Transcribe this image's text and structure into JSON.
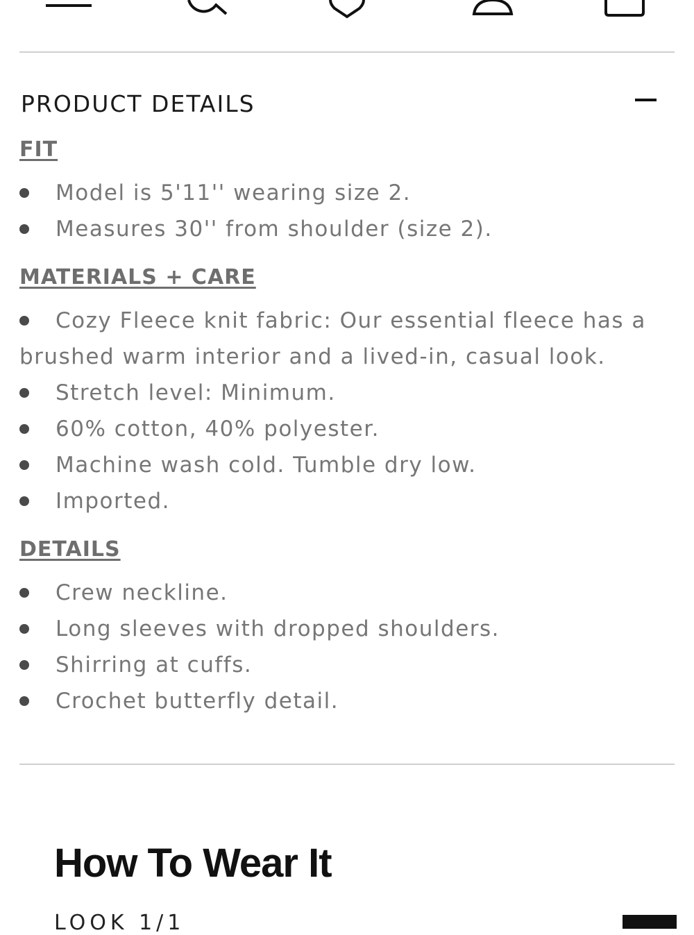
{
  "header": {
    "icons": [
      "menu-icon",
      "search-icon",
      "heart-icon",
      "account-icon",
      "bag-icon"
    ]
  },
  "product_details": {
    "title": "PRODUCT DETAILS",
    "collapse_icon": "minus-icon",
    "fit": {
      "heading": "FIT",
      "items": [
        "Model is 5'11'' wearing size 2.",
        "Measures 30'' from shoulder (size 2)."
      ]
    },
    "materials": {
      "heading": "MATERIALS + CARE",
      "items": [
        "Cozy Fleece knit fabric: Our essential fleece has a brushed warm interior and a lived-in, casual look.",
        "Stretch level: Minimum.",
        "60% cotton, 40% polyester.",
        "Machine wash cold. Tumble dry low.",
        "Imported."
      ]
    },
    "details": {
      "heading": "DETAILS",
      "items": [
        "Crew neckline.",
        "Long sleeves with dropped shoulders.",
        "Shirring at cuffs.",
        "Crochet butterfly detail."
      ]
    }
  },
  "how_to_wear": {
    "title": "How To Wear It",
    "look_label": "LOOK 1/1"
  }
}
